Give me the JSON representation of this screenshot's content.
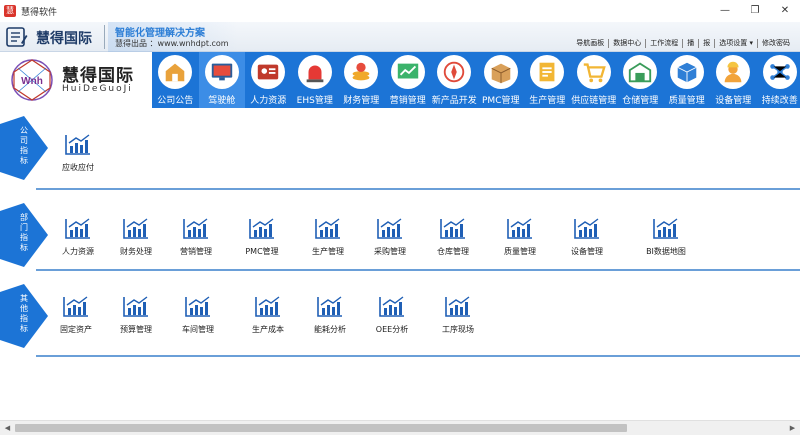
{
  "window": {
    "icon_text": "慧",
    "title": "慧得软件",
    "minimize": "—",
    "restore": "❐",
    "close": "✕"
  },
  "brand": {
    "name": "慧得国际",
    "slogan": "智能化管理解决方案",
    "site": "慧得出品 ：www.wnhdpt.com",
    "links": [
      "导航画板",
      "数据中心",
      "工作流程",
      "播",
      "报",
      "选项设置 ▾",
      "修改密码"
    ]
  },
  "logo": {
    "cn": "慧得国际",
    "en": "HuiDeGuoJi",
    "mark": "Wnh"
  },
  "nav": {
    "items": [
      {
        "label": "公司公告",
        "icon": "house-icon",
        "color": "#e9a23b"
      },
      {
        "label": "驾驶舱",
        "icon": "monitor-icon",
        "color": "#2a5d9a"
      },
      {
        "label": "人力资源",
        "icon": "id-card-icon",
        "color": "#c0392b"
      },
      {
        "label": "EHS管理",
        "icon": "alarm-icon",
        "color": "#e53935"
      },
      {
        "label": "财务管理",
        "icon": "coins-icon",
        "color": "#f0a92b"
      },
      {
        "label": "营销管理",
        "icon": "trend-board-icon",
        "color": "#3bb36b"
      },
      {
        "label": "新产品开发",
        "icon": "compass-icon",
        "color": "#e04a3a"
      },
      {
        "label": "PMC管理",
        "icon": "box-icon",
        "color": "#d9a05a"
      },
      {
        "label": "生产管理",
        "icon": "document-icon",
        "color": "#f2b634"
      },
      {
        "label": "供应链管理",
        "icon": "cart-icon",
        "color": "#f2b634"
      },
      {
        "label": "仓储管理",
        "icon": "warehouse-icon",
        "color": "#3a9c5a"
      },
      {
        "label": "质量管理",
        "icon": "cube-icon",
        "color": "#2f7fd6"
      },
      {
        "label": "设备管理",
        "icon": "worker-icon",
        "color": "#f2a33a"
      },
      {
        "label": "持续改善",
        "icon": "network-icon",
        "color": "#2f7fd6"
      }
    ]
  },
  "sections": [
    {
      "tab": "公司指标",
      "tiles": [
        {
          "label": "应收应付"
        }
      ]
    },
    {
      "tab": "部门指标",
      "tiles": [
        {
          "label": "人力资源"
        },
        {
          "label": "财务处理"
        },
        {
          "label": "营销管理"
        },
        {
          "label": "PMC管理"
        },
        {
          "label": "生产管理"
        },
        {
          "label": "采购管理"
        },
        {
          "label": "仓库管理"
        },
        {
          "label": "质量管理"
        },
        {
          "label": "设备管理"
        },
        {
          "label": "BI数据地图"
        }
      ]
    },
    {
      "tab": "其他指标",
      "tiles": [
        {
          "label": "固定资产"
        },
        {
          "label": "预算管理"
        },
        {
          "label": "车间管理"
        },
        {
          "label": "生产成本"
        },
        {
          "label": "能耗分析"
        },
        {
          "label": "OEE分析"
        },
        {
          "label": "工序现场"
        }
      ]
    }
  ],
  "scrollbar": {
    "left_arrow": "◀",
    "right_arrow": "▶"
  },
  "colors": {
    "accent": "#1c74d6",
    "nav_active": "#3c8de6",
    "icon_blue": "#1f5fb5",
    "section_tab": "#1c74d6"
  }
}
